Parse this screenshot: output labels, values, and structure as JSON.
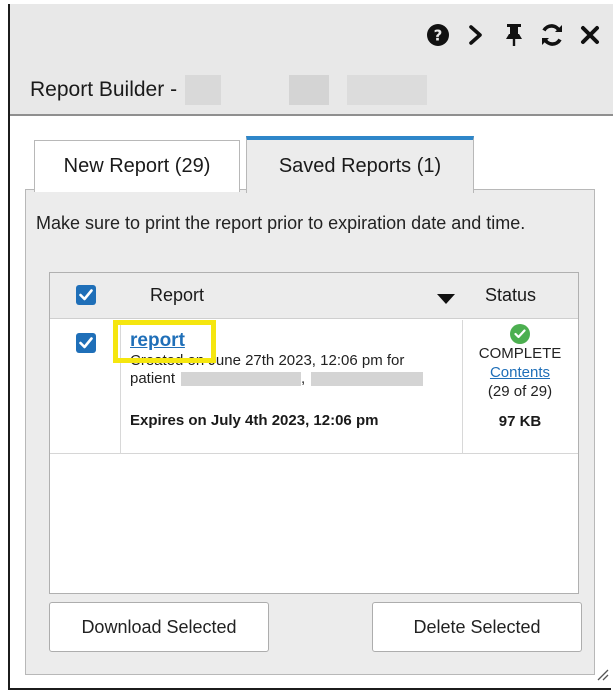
{
  "header": {
    "title": "Report Builder -",
    "icons": [
      "help-icon",
      "chevron-right-icon",
      "pin-icon",
      "refresh-icon",
      "close-icon"
    ]
  },
  "tabs": [
    {
      "label": "New Report (29)",
      "active": false
    },
    {
      "label": "Saved Reports (1)",
      "active": true
    }
  ],
  "notice": "Make sure to print the report prior to expiration date and time.",
  "table": {
    "headers": {
      "report": "Report",
      "status": "Status"
    },
    "rows": [
      {
        "link": "report",
        "created": "Created on June 27th 2023, 12:06 pm for",
        "patient_label": "patient",
        "patient_sep": ",",
        "expires": "Expires on July 4th 2023, 12:06 pm",
        "status": "COMPLETE",
        "contents_link": "Contents",
        "count": "(29 of 29)",
        "size": "97 KB",
        "checked": true
      }
    ]
  },
  "buttons": {
    "download": "Download Selected",
    "delete": "Delete Selected"
  },
  "colors": {
    "accent": "#1f6fb8",
    "tab_active_border": "#2e86c9",
    "highlight": "#f5e60f",
    "success": "#4caf50"
  }
}
